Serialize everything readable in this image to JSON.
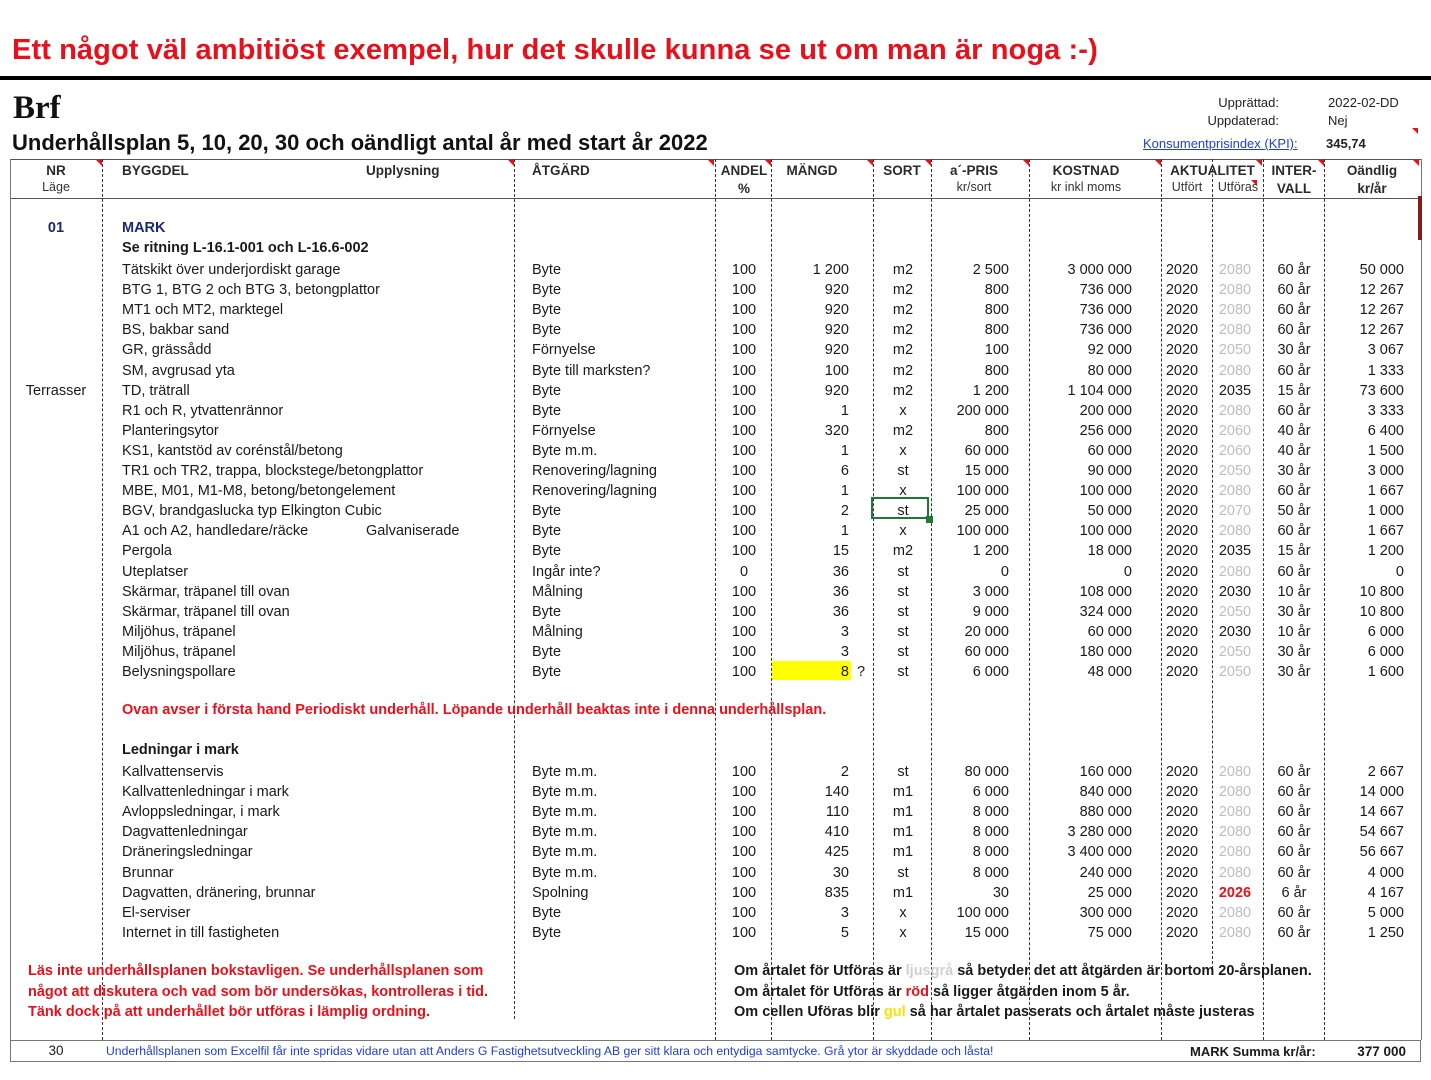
{
  "headline": "Ett något väl ambitiöst exempel, hur det skulle kunna se ut om man är noga :-)",
  "brf": "Brf",
  "plan_title": "Underhållsplan 5, 10, 20, 30 och oändligt antal år med start år  2022",
  "meta": {
    "upprattad_label": "Upprättad:",
    "upprattad_value": "2022-02-DD",
    "uppdaterad_label": "Uppdaterad:",
    "uppdaterad_value": "Nej",
    "kpi_label": "Konsumentprisindex (KPI):",
    "kpi_value": "345,74"
  },
  "headers": {
    "nr": "NR",
    "lage": "Läge",
    "byggdel": "BYGGDEL",
    "upplysning": "Upplysning",
    "atgard": "ÅTGÄRD",
    "andel": "ANDEL",
    "andel_unit": "%",
    "mangd": "MÄNGD",
    "sort": "SORT",
    "pris": "a´-PRIS",
    "pris_unit": "kr/sort",
    "kostnad": "KOSTNAD",
    "kostnad_unit": "kr inkl moms",
    "aktualitet": "AKTUALITET",
    "utfort": "Utfört",
    "utforas": "Utföras",
    "inter": "INTER-",
    "vall": "VALL",
    "oandlig": "Oändlig",
    "oandlig_unit": "kr/år"
  },
  "section": {
    "nr": "01",
    "name": "MARK",
    "subtitle": "Se ritning L-16.1-001 och L-16.6-002"
  },
  "rows": [
    {
      "lage": "",
      "byggdel": "Tätskikt över underjordiskt garage",
      "upp": "",
      "atg": "Byte",
      "andel": "100",
      "mangd": "1 200",
      "q": "",
      "sort": "m2",
      "pris": "2 500",
      "kost": "3 000 000",
      "utf": "2020",
      "utfo": "2080",
      "utfo_style": "grey",
      "int": "60 år",
      "oand": "50 000"
    },
    {
      "lage": "",
      "byggdel": "BTG 1, BTG 2 och BTG 3, betongplattor",
      "upp": "",
      "atg": "Byte",
      "andel": "100",
      "mangd": "920",
      "q": "",
      "sort": "m2",
      "pris": "800",
      "kost": "736 000",
      "utf": "2020",
      "utfo": "2080",
      "utfo_style": "grey",
      "int": "60 år",
      "oand": "12 267"
    },
    {
      "lage": "",
      "byggdel": "MT1 och MT2, marktegel",
      "upp": "",
      "atg": "Byte",
      "andel": "100",
      "mangd": "920",
      "q": "",
      "sort": "m2",
      "pris": "800",
      "kost": "736 000",
      "utf": "2020",
      "utfo": "2080",
      "utfo_style": "grey",
      "int": "60 år",
      "oand": "12 267"
    },
    {
      "lage": "",
      "byggdel": "BS, bakbar sand",
      "upp": "",
      "atg": "Byte",
      "andel": "100",
      "mangd": "920",
      "q": "",
      "sort": "m2",
      "pris": "800",
      "kost": "736 000",
      "utf": "2020",
      "utfo": "2080",
      "utfo_style": "grey",
      "int": "60 år",
      "oand": "12 267"
    },
    {
      "lage": "",
      "byggdel": "GR, grässådd",
      "upp": "",
      "atg": "Förnyelse",
      "andel": "100",
      "mangd": "920",
      "q": "",
      "sort": "m2",
      "pris": "100",
      "kost": "92 000",
      "utf": "2020",
      "utfo": "2050",
      "utfo_style": "grey",
      "int": "30 år",
      "oand": "3 067"
    },
    {
      "lage": "",
      "byggdel": "SM, avgrusad yta",
      "upp": "",
      "atg": "Byte till marksten?",
      "andel": "100",
      "mangd": "100",
      "q": "",
      "sort": "m2",
      "pris": "800",
      "kost": "80 000",
      "utf": "2020",
      "utfo": "2080",
      "utfo_style": "grey",
      "int": "60 år",
      "oand": "1 333"
    },
    {
      "lage": "Terrasser",
      "byggdel": "TD, trätrall",
      "upp": "",
      "atg": "Byte",
      "andel": "100",
      "mangd": "920",
      "q": "",
      "sort": "m2",
      "pris": "1 200",
      "kost": "1 104 000",
      "utf": "2020",
      "utfo": "2035",
      "utfo_style": "",
      "int": "15 år",
      "oand": "73 600"
    },
    {
      "lage": "",
      "byggdel": "R1 och R, ytvattenrännor",
      "upp": "",
      "atg": "Byte",
      "andel": "100",
      "mangd": "1",
      "q": "",
      "sort": "x",
      "pris": "200 000",
      "kost": "200 000",
      "utf": "2020",
      "utfo": "2080",
      "utfo_style": "grey",
      "int": "60 år",
      "oand": "3 333"
    },
    {
      "lage": "",
      "byggdel": "Planteringsytor",
      "upp": "",
      "atg": "Förnyelse",
      "andel": "100",
      "mangd": "320",
      "q": "",
      "sort": "m2",
      "pris": "800",
      "kost": "256 000",
      "utf": "2020",
      "utfo": "2060",
      "utfo_style": "grey",
      "int": "40 år",
      "oand": "6 400"
    },
    {
      "lage": "",
      "byggdel": "KS1, kantstöd av corénstål/betong",
      "upp": "",
      "atg": "Byte m.m.",
      "andel": "100",
      "mangd": "1",
      "q": "",
      "sort": "x",
      "pris": "60 000",
      "kost": "60 000",
      "utf": "2020",
      "utfo": "2060",
      "utfo_style": "grey",
      "int": "40 år",
      "oand": "1 500"
    },
    {
      "lage": "",
      "byggdel": "TR1 och TR2, trappa, blockstege/betongplattor",
      "upp": "",
      "atg": "Renovering/lagning",
      "andel": "100",
      "mangd": "6",
      "q": "",
      "sort": "st",
      "pris": "15 000",
      "kost": "90 000",
      "utf": "2020",
      "utfo": "2050",
      "utfo_style": "grey",
      "int": "30 år",
      "oand": "3 000"
    },
    {
      "lage": "",
      "byggdel": "MBE, M01, M1-M8, betong/betongelement",
      "upp": "",
      "atg": "Renovering/lagning",
      "andel": "100",
      "mangd": "1",
      "q": "",
      "sort": "x",
      "pris": "100 000",
      "kost": "100 000",
      "utf": "2020",
      "utfo": "2080",
      "utfo_style": "grey",
      "int": "60 år",
      "oand": "1 667"
    },
    {
      "lage": "",
      "byggdel": "BGV, brandgaslucka typ Elkington Cubic",
      "upp": "",
      "atg": "Byte",
      "andel": "100",
      "mangd": "2",
      "q": "",
      "sort": "st",
      "pris": "25 000",
      "kost": "50 000",
      "utf": "2020",
      "utfo": "2070",
      "utfo_style": "grey",
      "int": "50 år",
      "oand": "1 000"
    },
    {
      "lage": "",
      "byggdel": "A1 och A2, handledare/räcke",
      "upp": "Galvaniserade",
      "atg": "Byte",
      "andel": "100",
      "mangd": "1",
      "q": "",
      "sort": "x",
      "pris": "100 000",
      "kost": "100 000",
      "utf": "2020",
      "utfo": "2080",
      "utfo_style": "grey",
      "int": "60 år",
      "oand": "1 667"
    },
    {
      "lage": "",
      "byggdel": "Pergola",
      "upp": "",
      "atg": "Byte",
      "andel": "100",
      "mangd": "15",
      "q": "",
      "sort": "m2",
      "pris": "1 200",
      "kost": "18 000",
      "utf": "2020",
      "utfo": "2035",
      "utfo_style": "",
      "int": "15 år",
      "oand": "1 200"
    },
    {
      "lage": "",
      "byggdel": "Uteplatser",
      "upp": "",
      "atg": "Ingår inte?",
      "andel": "0",
      "mangd": "36",
      "q": "",
      "sort": "st",
      "pris": "0",
      "kost": "0",
      "utf": "2020",
      "utfo": "2080",
      "utfo_style": "grey",
      "int": "60 år",
      "oand": "0"
    },
    {
      "lage": "",
      "byggdel": "Skärmar, träpanel till ovan",
      "upp": "",
      "atg": "Målning",
      "andel": "100",
      "mangd": "36",
      "q": "",
      "sort": "st",
      "pris": "3 000",
      "kost": "108 000",
      "utf": "2020",
      "utfo": "2030",
      "utfo_style": "",
      "int": "10 år",
      "oand": "10 800"
    },
    {
      "lage": "",
      "byggdel": "Skärmar, träpanel till ovan",
      "upp": "",
      "atg": "Byte",
      "andel": "100",
      "mangd": "36",
      "q": "",
      "sort": "st",
      "pris": "9 000",
      "kost": "324 000",
      "utf": "2020",
      "utfo": "2050",
      "utfo_style": "grey",
      "int": "30 år",
      "oand": "10 800"
    },
    {
      "lage": "",
      "byggdel": "Miljöhus, träpanel",
      "upp": "",
      "atg": "Målning",
      "andel": "100",
      "mangd": "3",
      "q": "",
      "sort": "st",
      "pris": "20 000",
      "kost": "60 000",
      "utf": "2020",
      "utfo": "2030",
      "utfo_style": "",
      "int": "10 år",
      "oand": "6 000"
    },
    {
      "lage": "",
      "byggdel": "Miljöhus, träpanel",
      "upp": "",
      "atg": "Byte",
      "andel": "100",
      "mangd": "3",
      "q": "",
      "sort": "st",
      "pris": "60 000",
      "kost": "180 000",
      "utf": "2020",
      "utfo": "2050",
      "utfo_style": "grey",
      "int": "30 år",
      "oand": "6 000"
    },
    {
      "lage": "",
      "byggdel": "Belysningspollare",
      "upp": "",
      "atg": "Byte",
      "andel": "100",
      "mangd": "8",
      "q": "?",
      "sort": "st",
      "pris": "6 000",
      "kost": "48 000",
      "utf": "2020",
      "utfo": "2050",
      "utfo_style": "grey",
      "int": "30 år",
      "oand": "1 600"
    }
  ],
  "periodic_note": "Ovan avser i första hand Periodiskt underhåll. Löpande underhåll beaktas inte i denna underhållsplan.",
  "ledningar_title": "Ledningar i mark",
  "rows2": [
    {
      "byggdel": "Kallvattenservis",
      "atg": "Byte m.m.",
      "andel": "100",
      "mangd": "2",
      "sort": "st",
      "pris": "80 000",
      "kost": "160 000",
      "utf": "2020",
      "utfo": "2080",
      "utfo_style": "grey",
      "int": "60 år",
      "oand": "2 667"
    },
    {
      "byggdel": "Kallvattenledningar i mark",
      "atg": "Byte m.m.",
      "andel": "100",
      "mangd": "140",
      "sort": "m1",
      "pris": "6 000",
      "kost": "840 000",
      "utf": "2020",
      "utfo": "2080",
      "utfo_style": "grey",
      "int": "60 år",
      "oand": "14 000"
    },
    {
      "byggdel": "Avloppsledningar, i mark",
      "atg": "Byte m.m.",
      "andel": "100",
      "mangd": "110",
      "sort": "m1",
      "pris": "8 000",
      "kost": "880 000",
      "utf": "2020",
      "utfo": "2080",
      "utfo_style": "grey",
      "int": "60 år",
      "oand": "14 667"
    },
    {
      "byggdel": "Dagvattenledningar",
      "atg": "Byte m.m.",
      "andel": "100",
      "mangd": "410",
      "sort": "m1",
      "pris": "8 000",
      "kost": "3 280 000",
      "utf": "2020",
      "utfo": "2080",
      "utfo_style": "grey",
      "int": "60 år",
      "oand": "54 667"
    },
    {
      "byggdel": "Dräneringsledningar",
      "atg": "Byte m.m.",
      "andel": "100",
      "mangd": "425",
      "sort": "m1",
      "pris": "8 000",
      "kost": "3 400 000",
      "utf": "2020",
      "utfo": "2080",
      "utfo_style": "grey",
      "int": "60 år",
      "oand": "56 667"
    },
    {
      "byggdel": "Brunnar",
      "atg": "Byte m.m.",
      "andel": "100",
      "mangd": "30",
      "sort": "st",
      "pris": "8 000",
      "kost": "240 000",
      "utf": "2020",
      "utfo": "2080",
      "utfo_style": "grey",
      "int": "60 år",
      "oand": "4 000"
    },
    {
      "byggdel": "Dagvatten, dränering, brunnar",
      "atg": "Spolning",
      "andel": "100",
      "mangd": "835",
      "sort": "m1",
      "pris": "30",
      "kost": "25 000",
      "utf": "2020",
      "utfo": "2026",
      "utfo_style": "red",
      "int": "6 år",
      "oand": "4 167"
    },
    {
      "byggdel": "El-serviser",
      "atg": "Byte",
      "andel": "100",
      "mangd": "3",
      "sort": "x",
      "pris": "100 000",
      "kost": "300 000",
      "utf": "2020",
      "utfo": "2080",
      "utfo_style": "grey",
      "int": "60 år",
      "oand": "5 000"
    },
    {
      "byggdel": "Internet in till fastigheten",
      "atg": "Byte",
      "andel": "100",
      "mangd": "5",
      "sort": "x",
      "pris": "15 000",
      "kost": "75 000",
      "utf": "2020",
      "utfo": "2080",
      "utfo_style": "grey",
      "int": "60 år",
      "oand": "1 250"
    }
  ],
  "warnings": [
    "Läs inte underhållsplanen bokstavligen.  Se underhållsplanen som",
    "något att diskutera och vad som bör undersökas, kontrolleras i tid.",
    "Tänk dock på att underhållet bör utföras i lämplig ordning."
  ],
  "legend": {
    "l1_pre": "Om årtalet för Utföras är ",
    "l1_word": "ljusgrå",
    "l1_post": " så betyder det att åtgärden är bortom 20-årsplanen.",
    "l2_pre": "Om årtalet för Utföras är ",
    "l2_word": "röd",
    "l2_post": " så ligger åtgärden inom 5 år.",
    "l3_pre": "Om cellen Uföras blir ",
    "l3_word": "gul",
    "l3_post": " så har årtalet passerats och årtalet måste justeras"
  },
  "footer": {
    "page": "30",
    "notice": "Underhållsplanen som Excelfil får inte spridas vidare utan att Anders G Fastighetsutveckling AB ger sitt klara och entydiga samtycke. Grå ytor är skyddade och låsta!",
    "sum_label": "MARK Summa kr/år:",
    "sum_value": "377 000"
  },
  "colors": {
    "red": "#e8101a",
    "grey_year": "#bdbdbd",
    "yellow": "#ffff00",
    "link_blue": "#1f3fd0",
    "selection_green": "#1d7a34"
  }
}
